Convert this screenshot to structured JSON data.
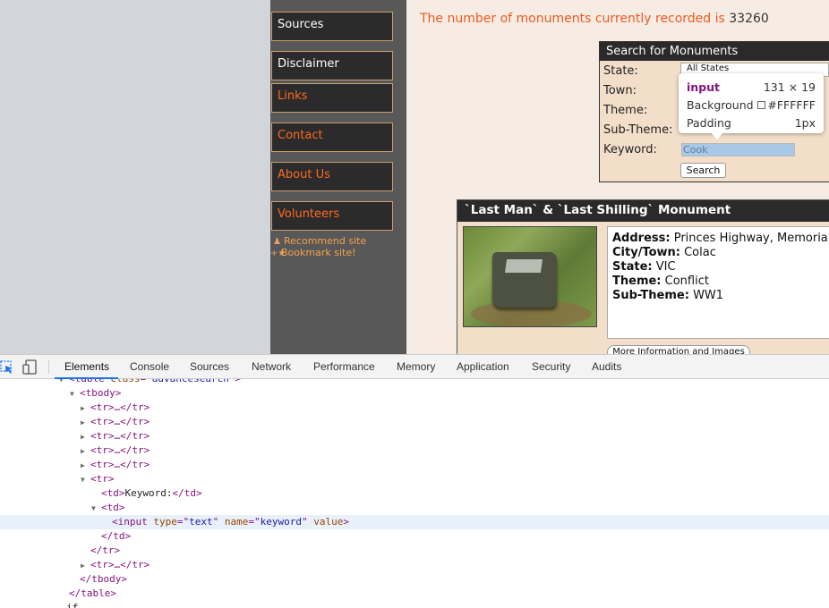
{
  "site": {
    "nav": [
      {
        "label": "Sources",
        "accent": false
      },
      {
        "label": "Disclaimer",
        "accent": false
      },
      {
        "label": "Links",
        "accent": true
      },
      {
        "label": "Contact",
        "accent": true
      },
      {
        "label": "About Us",
        "accent": true
      },
      {
        "label": "Volunteers",
        "accent": true
      }
    ],
    "side_links": {
      "recommend": "Recommend site",
      "bookmark": "Bookmark site!"
    },
    "count_text": "The number of monuments currently recorded is",
    "count_value": "33260",
    "search": {
      "title": "Search for Monuments",
      "state_label": "State:",
      "town_label": "Town:",
      "theme_label": "Theme:",
      "subtheme_label": "Sub-Theme:",
      "keyword_label": "Keyword:",
      "state_value": "All States",
      "keyword_value": "Cook",
      "button_label": "Search"
    },
    "inspect_tooltip": {
      "tag": "input",
      "dimensions": "131 × 19",
      "background_label": "Background",
      "background_value": "#FFFFFF",
      "padding_label": "Padding",
      "padding_value": "1px"
    },
    "monument": {
      "title": "`Last Man` & `Last Shilling` Monument",
      "address_label": "Address:",
      "address_value": "Princes Highway, Memorial",
      "city_label": "City/Town:",
      "city_value": "Colac",
      "state_label": "State:",
      "state_value": "VIC",
      "theme_label": "Theme:",
      "theme_value": "Conflict",
      "subtheme_label": "Sub-Theme:",
      "subtheme_value": "WW1",
      "more_button": "More Information and Images"
    }
  },
  "devtools": {
    "tabs": [
      "Elements",
      "Console",
      "Sources",
      "Network",
      "Performance",
      "Memory",
      "Application",
      "Security",
      "Audits"
    ],
    "active_tab": "Elements",
    "dom": {
      "table_open_tag": "table",
      "table_class_attr": "class",
      "table_class_value": "advancesearch",
      "tbody": "tbody",
      "collapsed_tr": "<tr>…</tr>",
      "tr": "tr",
      "td": "td",
      "td_text": "Keyword:",
      "input_tag": "input",
      "attr_type": "type",
      "attr_type_value": "text",
      "attr_name": "name",
      "attr_name_value": "keyword",
      "attr_value": "value",
      "close_td": "</td>",
      "close_tr": "</tr>",
      "close_tbody": "</tbody>",
      "close_table": "</table>",
      "last_line": "if"
    }
  },
  "colors": {
    "accent_orange": "#ef5a22",
    "sidebar_bg": "#585858",
    "content_bg": "#f6ece3",
    "selection_blue": "#1a73e8"
  }
}
